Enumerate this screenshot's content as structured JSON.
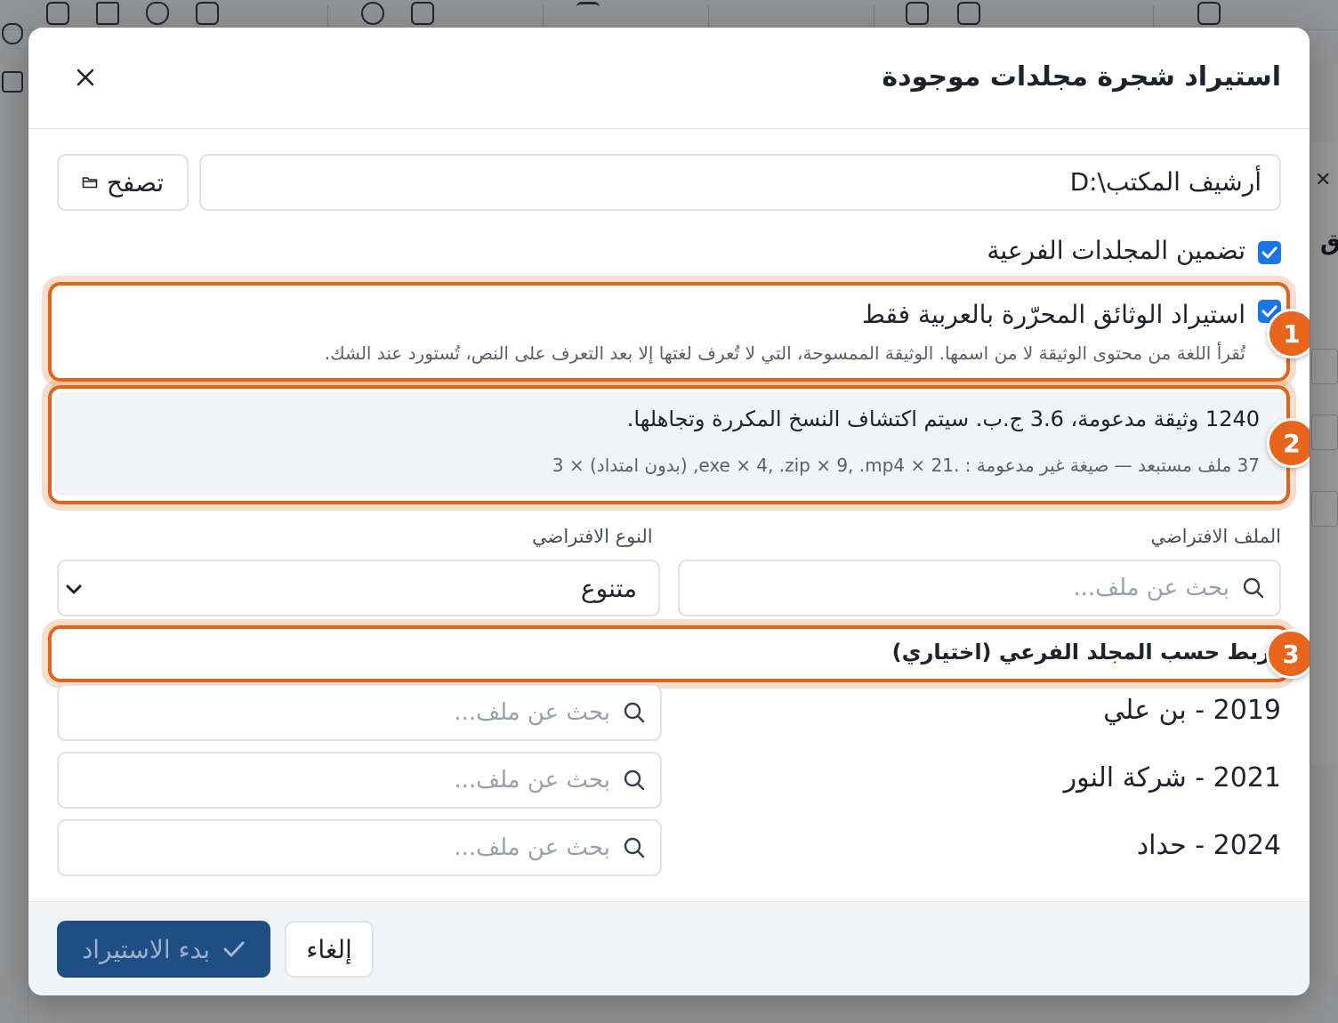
{
  "dialog": {
    "title": "استيراد شجرة مجلدات موجودة",
    "folder_path": "D:\\أرشيف المكتب",
    "browse_label": "تصفح",
    "include_subfolders_label": "تضمين المجلدات الفرعية",
    "include_subfolders_checked": true,
    "arabic_only_label": "استيراد الوثائق المحرّرة بالعربية فقط",
    "arabic_only_checked": true,
    "arabic_only_hint": "تُقرأ اللغة من محتوى الوثيقة لا من اسمها. الوثيقة الممسوحة، التي لا تُعرف لغتها إلا بعد التعرف على النص، تُستورد عند الشك.",
    "summary_main": "1240 وثيقة مدعومة، 3.6 ج.ب. سيتم اكتشاف النسخ المكررة وتجاهلها.",
    "summary_excluded": "37 ملف مستبعد — صيغة غير مدعومة : .exe × 4, .zip × 9, .mp4 × 21, (بدون امتداد) × 3",
    "default_file_label": "الملف الافتراضي",
    "default_file_placeholder": "بحث عن ملف...",
    "default_type_label": "النوع الافتراضي",
    "default_type_value": "متنوع",
    "subfolder_mapping_title": "ربط حسب المجلد الفرعي (اختياري)",
    "subfolder_mappings": [
      {
        "name": "2019 - بن علي",
        "placeholder": "بحث عن ملف..."
      },
      {
        "name": "2021 - شركة النور",
        "placeholder": "بحث عن ملف..."
      },
      {
        "name": "2024 - حداد",
        "placeholder": "بحث عن ملف..."
      }
    ],
    "cancel_label": "إلغاء",
    "start_label": "بدء الاستيراد"
  },
  "annotations": [
    "1",
    "2",
    "3"
  ],
  "colors": {
    "accent": "#1976e6",
    "primary_button": "#1f4e85",
    "highlight": "#e1641a"
  }
}
